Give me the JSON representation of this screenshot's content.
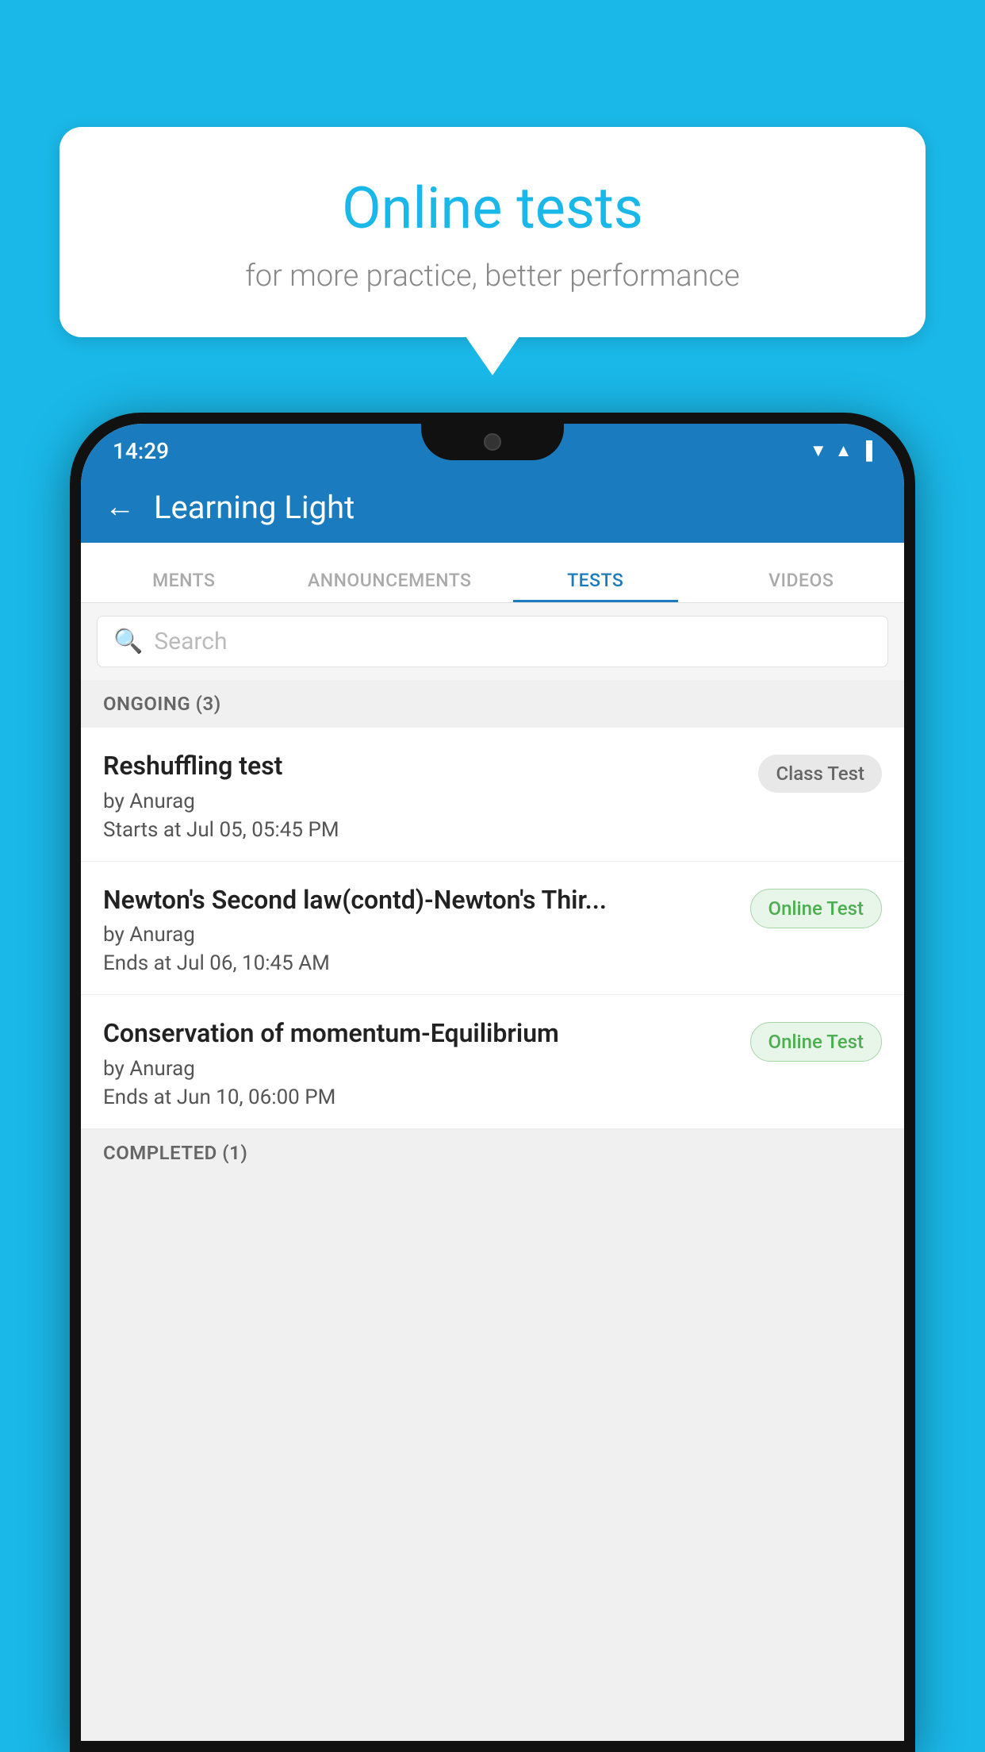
{
  "background_color": "#1ab8e8",
  "bubble": {
    "title": "Online tests",
    "subtitle": "for more practice, better performance"
  },
  "phone": {
    "status_bar": {
      "time": "14:29",
      "icons": [
        "wifi",
        "signal",
        "battery"
      ]
    },
    "header": {
      "title": "Learning Light",
      "back_label": "←"
    },
    "tabs": [
      {
        "label": "MENTS",
        "active": false
      },
      {
        "label": "ANNOUNCEMENTS",
        "active": false
      },
      {
        "label": "TESTS",
        "active": true
      },
      {
        "label": "VIDEOS",
        "active": false
      }
    ],
    "search": {
      "placeholder": "Search"
    },
    "ongoing_section": {
      "header": "ONGOING (3)",
      "tests": [
        {
          "name": "Reshuffling test",
          "author": "by Anurag",
          "date": "Starts at  Jul 05, 05:45 PM",
          "badge": "Class Test",
          "badge_type": "class"
        },
        {
          "name": "Newton's Second law(contd)-Newton's Thir...",
          "author": "by Anurag",
          "date": "Ends at  Jul 06, 10:45 AM",
          "badge": "Online Test",
          "badge_type": "online"
        },
        {
          "name": "Conservation of momentum-Equilibrium",
          "author": "by Anurag",
          "date": "Ends at  Jun 10, 06:00 PM",
          "badge": "Online Test",
          "badge_type": "online"
        }
      ]
    },
    "completed_section": {
      "header": "COMPLETED (1)"
    }
  }
}
